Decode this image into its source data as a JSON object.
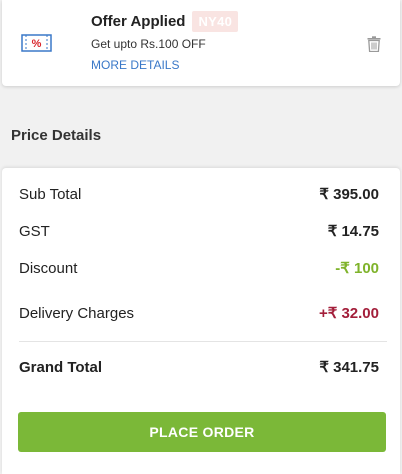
{
  "offer": {
    "title": "Offer Applied",
    "code": "NY40",
    "description": "Get upto Rs.100 OFF",
    "details_link": "MORE DETAILS"
  },
  "price_details": {
    "heading": "Price Details",
    "rows": [
      {
        "label": "Sub Total",
        "value": "₹ 395.00"
      },
      {
        "label": "GST",
        "value": "₹ 14.75"
      },
      {
        "label": "Discount",
        "value": "-₹ 100"
      },
      {
        "label": "Delivery Charges",
        "value": "+₹ 32.00"
      }
    ],
    "grand_total": {
      "label": "Grand Total",
      "value": "₹ 341.75"
    }
  },
  "actions": {
    "place_order": "PLACE ORDER"
  },
  "colors": {
    "accent_green": "#7bb838",
    "discount_green": "#7fb32b",
    "delivery_red": "#a31e3a",
    "link_blue": "#3a78c8",
    "coupon_code_bg": "#f9e4e2"
  },
  "icons": {
    "coupon": "coupon-percent-icon",
    "delete": "trash-icon"
  }
}
